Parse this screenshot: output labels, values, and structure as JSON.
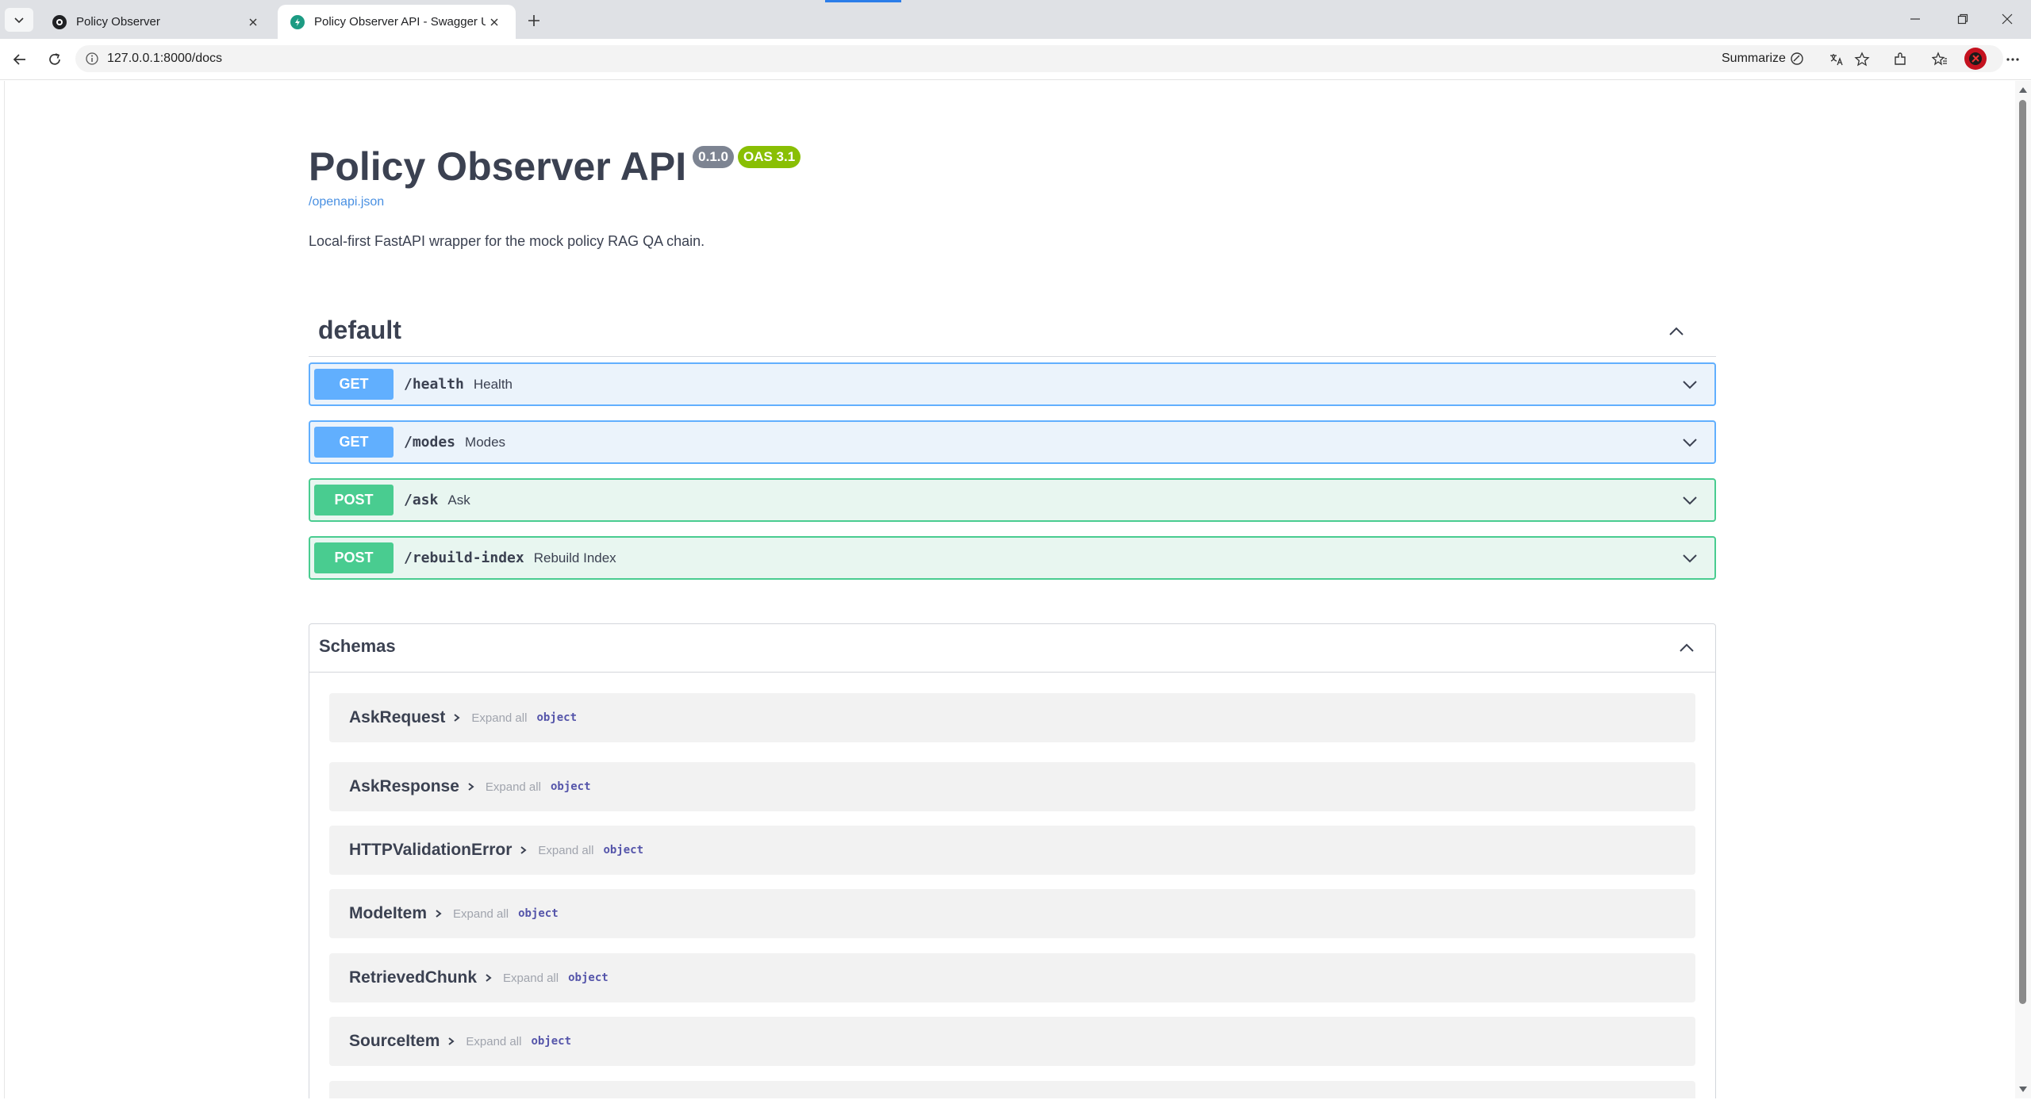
{
  "browser": {
    "tabs": [
      {
        "title": "Policy Observer",
        "active": false
      },
      {
        "title": "Policy Observer API - Swagger UI",
        "active": true
      }
    ],
    "url": "127.0.0.1:8000/docs",
    "summarize_label": "Summarize"
  },
  "info": {
    "title": "Policy Observer API",
    "version": "0.1.0",
    "oas_version": "OAS 3.1",
    "spec_link": "/openapi.json",
    "description": "Local-first FastAPI wrapper for the mock policy RAG QA chain."
  },
  "tag": {
    "name": "default"
  },
  "operations": [
    {
      "method": "GET",
      "path": "/health",
      "summary": "Health"
    },
    {
      "method": "GET",
      "path": "/modes",
      "summary": "Modes"
    },
    {
      "method": "POST",
      "path": "/ask",
      "summary": "Ask"
    },
    {
      "method": "POST",
      "path": "/rebuild-index",
      "summary": "Rebuild Index"
    }
  ],
  "schemas": {
    "title": "Schemas",
    "items": [
      {
        "name": "AskRequest",
        "expand_label": "Expand all",
        "type": "object"
      },
      {
        "name": "AskResponse",
        "expand_label": "Expand all",
        "type": "object"
      },
      {
        "name": "HTTPValidationError",
        "expand_label": "Expand all",
        "type": "object"
      },
      {
        "name": "ModeItem",
        "expand_label": "Expand all",
        "type": "object"
      },
      {
        "name": "RetrievedChunk",
        "expand_label": "Expand all",
        "type": "object"
      },
      {
        "name": "SourceItem",
        "expand_label": "Expand all",
        "type": "object"
      }
    ]
  },
  "colors": {
    "get": "#61affe",
    "post": "#49cc90",
    "version_badge": "#7d8492",
    "oas_badge": "#89bf04",
    "link": "#4990e2"
  }
}
